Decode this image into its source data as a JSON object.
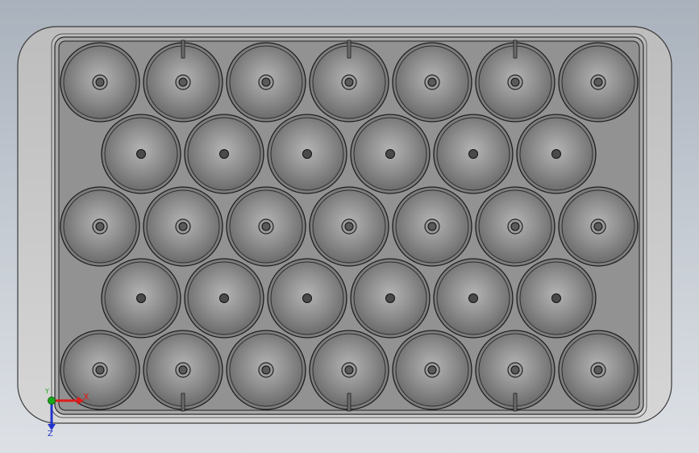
{
  "viewport": {
    "background_top": "#a9b1bc",
    "background_bottom": "#dde1e6"
  },
  "tray": {
    "outer_color": "#c9c9c9",
    "frame_color": "#9a9a9a",
    "inner_color": "#8f8f8f",
    "edge_color": "#2a2a2a",
    "rows": [
      {
        "count": 7,
        "hole": "ring"
      },
      {
        "count": 6,
        "hole": "dot"
      },
      {
        "count": 7,
        "hole": "ring"
      },
      {
        "count": 6,
        "hole": "dot"
      },
      {
        "count": 7,
        "hole": "ring"
      }
    ],
    "pocket_count": 33
  },
  "triad": {
    "x_axis": {
      "label": "X",
      "color": "#e01b1b"
    },
    "y_axis": {
      "label": "Y",
      "color": "#1aa81a"
    },
    "z_axis": {
      "label": "Z",
      "color": "#2233cc"
    }
  }
}
